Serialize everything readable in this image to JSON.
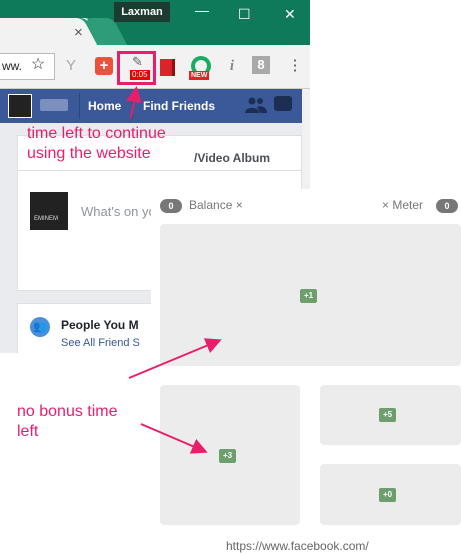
{
  "browser": {
    "profile_name": "Laxman",
    "tab_close": "×",
    "address_text": "ww.",
    "window_controls": [
      "—",
      "☐",
      "✕"
    ],
    "menu_glyph": "⋮",
    "extensions": {
      "time_meter_badge": "0:05",
      "new_badge": "NEW",
      "info_glyph": "i",
      "gplus_glyph": "8"
    }
  },
  "facebook": {
    "nav": {
      "home": "Home",
      "find_friends": "Find Friends"
    },
    "album_text": "/Video Album",
    "composer_placeholder": "What's on yo",
    "avatar_caption": "EMINEM",
    "people_title": "People You M",
    "see_all": "See All Friend S",
    "people_icon": "👥"
  },
  "popup": {
    "balance_value": "0",
    "balance_label": "Balance ×",
    "meter_label": "× Meter",
    "meter_value": "0",
    "tiles": [
      "+1",
      "+3",
      "+5",
      "+0"
    ],
    "url": "https://www.facebook.com/"
  },
  "annotations": {
    "time_left": "time left to continue\nusing the website",
    "no_bonus": "no bonus time\nleft"
  },
  "colors": {
    "accent": "#e81e6c",
    "facebook_blue": "#3b5998",
    "chrome_green": "#0f7a5a",
    "tile_green": "#6d9e6b"
  },
  "icons": [
    "star-icon",
    "plus-extension-icon",
    "time-meter-icon",
    "book-icon",
    "new-extension-icon",
    "info-icon",
    "google-plus-icon",
    "menu-icon",
    "friends-icon",
    "messages-icon"
  ]
}
